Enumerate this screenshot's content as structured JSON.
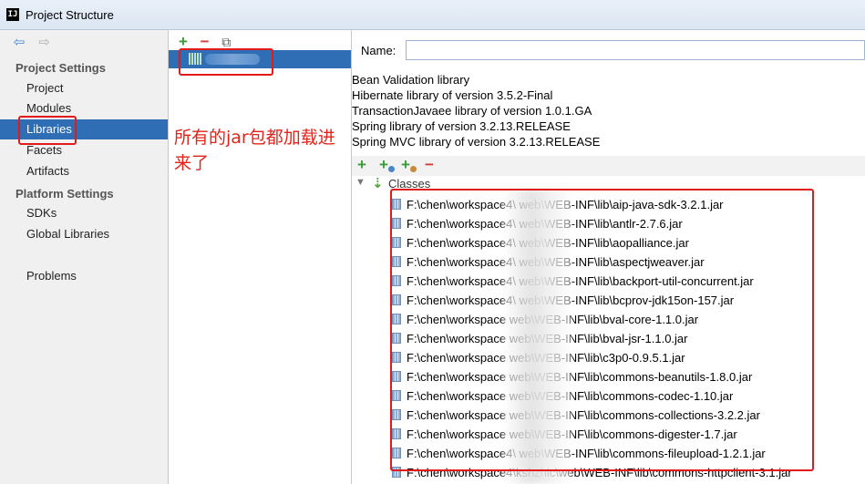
{
  "window": {
    "title": "Project Structure",
    "app_icon_text": "IJ"
  },
  "nav": {
    "back_icon": "arrow-left",
    "forward_icon": "arrow-right",
    "project_settings_header": "Project Settings",
    "platform_settings_header": "Platform Settings",
    "items": [
      {
        "label": "Project",
        "selected": false
      },
      {
        "label": "Modules",
        "selected": false
      },
      {
        "label": "Libraries",
        "selected": true
      },
      {
        "label": "Facets",
        "selected": false
      },
      {
        "label": "Artifacts",
        "selected": false
      },
      {
        "label": "SDKs",
        "selected": false
      },
      {
        "label": "Global Libraries",
        "selected": false
      },
      {
        "label": "Problems",
        "selected": false
      }
    ]
  },
  "middle": {
    "add_icon": "+",
    "remove_icon": "−",
    "copy_icon": "copy",
    "annotation": "所有的jar包都加载进来了"
  },
  "detail": {
    "name_label": "Name:",
    "name_value": "",
    "descriptions": [
      "Bean Validation library",
      "Hibernate library of version 3.5.2-Final",
      "TransactionJavaee library of version 1.0.1.GA",
      "Spring library of version 3.2.13.RELEASE",
      "Spring MVC library of version 3.2.13.RELEASE"
    ],
    "classes_label": "Classes",
    "jars": [
      "F:\\chen\\workspace4\\           web\\WEB-INF\\lib\\aip-java-sdk-3.2.1.jar",
      "F:\\chen\\workspace4\\           web\\WEB-INF\\lib\\antlr-2.7.6.jar",
      "F:\\chen\\workspace4\\           web\\WEB-INF\\lib\\aopalliance.jar",
      "F:\\chen\\workspace4\\           web\\WEB-INF\\lib\\aspectjweaver.jar",
      "F:\\chen\\workspace4\\           web\\WEB-INF\\lib\\backport-util-concurrent.jar",
      "F:\\chen\\workspace4\\           web\\WEB-INF\\lib\\bcprov-jdk15on-157.jar",
      "F:\\chen\\workspace            web\\WEB-INF\\lib\\bval-core-1.1.0.jar",
      "F:\\chen\\workspace            web\\WEB-INF\\lib\\bval-jsr-1.1.0.jar",
      "F:\\chen\\workspace            web\\WEB-INF\\lib\\c3p0-0.9.5.1.jar",
      "F:\\chen\\workspace            web\\WEB-INF\\lib\\commons-beanutils-1.8.0.jar",
      "F:\\chen\\workspace            web\\WEB-INF\\lib\\commons-codec-1.10.jar",
      "F:\\chen\\workspace            web\\WEB-INF\\lib\\commons-collections-3.2.2.jar",
      "F:\\chen\\workspace            web\\WEB-INF\\lib\\commons-digester-1.7.jar",
      "F:\\chen\\workspace4\\           web\\WEB-INF\\lib\\commons-fileupload-1.2.1.jar",
      "F:\\chen\\workspace4\\kshzhic\\web\\WEB-INF\\lib\\commons-httpclient-3.1.jar"
    ]
  },
  "colors": {
    "selection": "#2f6db5",
    "highlight_box": "#e21a1a",
    "annotation_text": "#e2231a",
    "add_green": "#3a9a3a",
    "remove_red": "#d23b3b"
  }
}
